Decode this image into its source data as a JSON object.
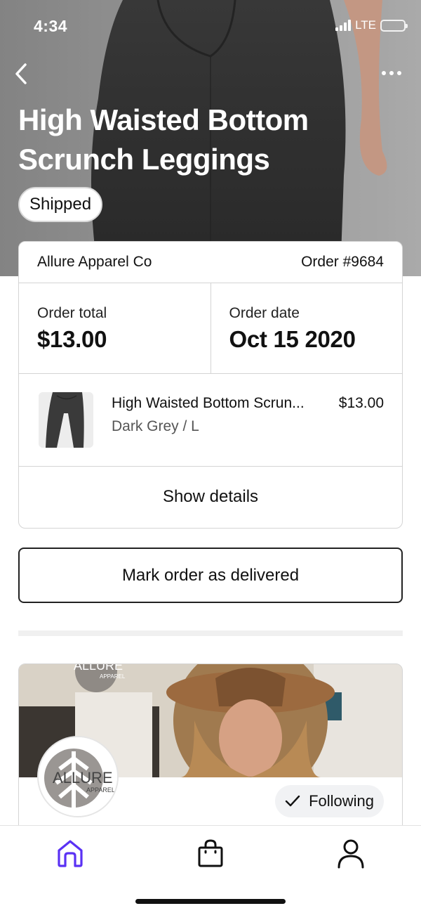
{
  "status_bar": {
    "time": "4:34",
    "network": "LTE"
  },
  "header": {
    "back_icon": "chevron-left-icon",
    "more_icon": "more-horizontal-icon",
    "title": "High Waisted Bottom Scrunch Leggings",
    "status_badge": "Shipped"
  },
  "order": {
    "store_name": "Allure Apparel Co",
    "order_number": "Order #9684",
    "total_label": "Order total",
    "total_value": "$13.00",
    "date_label": "Order date",
    "date_value": "Oct 15 2020",
    "item": {
      "name": "High Waisted Bottom Scrun...",
      "price": "$13.00",
      "variant": "Dark Grey / L"
    },
    "show_details_label": "Show details"
  },
  "actions": {
    "mark_delivered_label": "Mark order as delivered"
  },
  "shop": {
    "logo_text": "ALLURE",
    "logo_sub": "APPAREL",
    "following_label": "Following",
    "following_icon": "checkmark-icon"
  },
  "tabbar": {
    "items": [
      {
        "icon": "home-icon",
        "active": true
      },
      {
        "icon": "shopping-bag-icon",
        "active": false
      },
      {
        "icon": "profile-icon",
        "active": false
      }
    ]
  },
  "colors": {
    "accent": "#5a31f4",
    "battery": "#f7d43a"
  }
}
